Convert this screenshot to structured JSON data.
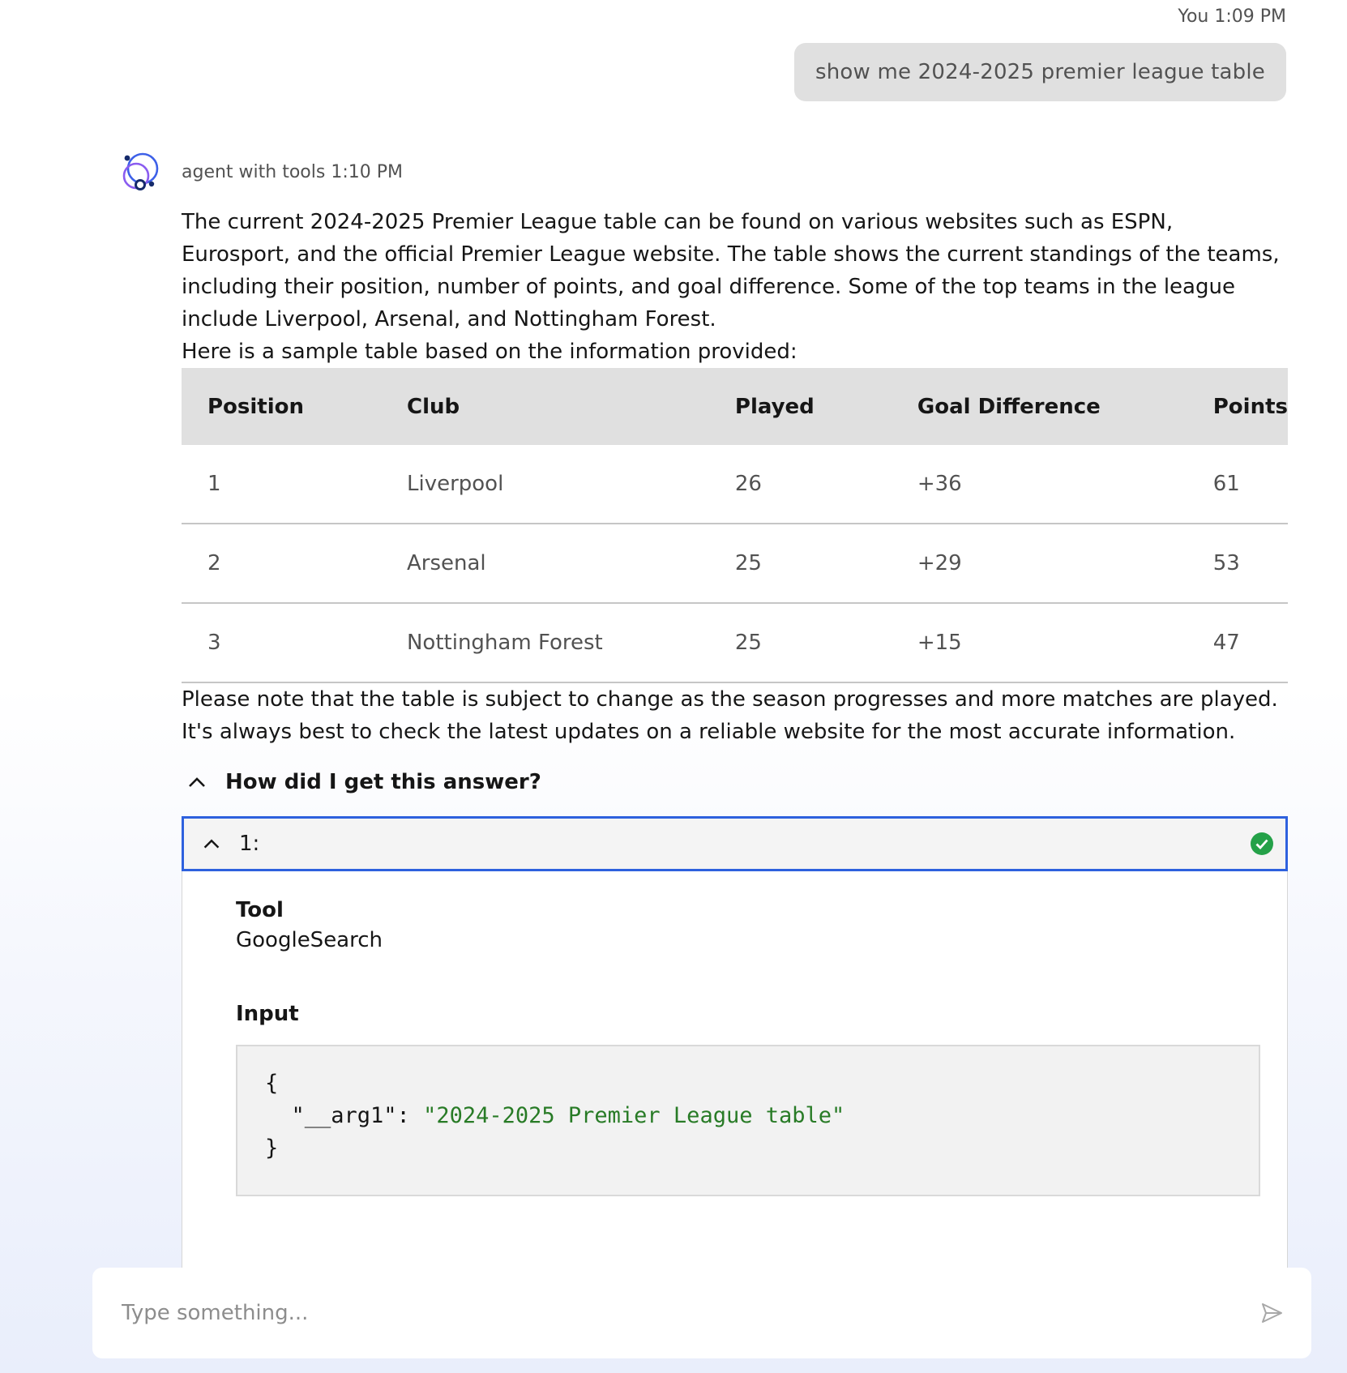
{
  "user_message": {
    "sender": "You",
    "time": "1:09 PM",
    "text": "show me 2024-2025 premier league table"
  },
  "agent_message": {
    "sender": "agent with tools",
    "time": "1:10 PM",
    "intro": "The current 2024-2025 Premier League table can be found on various websites such as ESPN, Eurosport, and the official Premier League website. The table shows the current standings of the teams, including their position, number of points, and goal difference. Some of the top teams in the league include Liverpool, Arsenal, and Nottingham Forest.",
    "table_intro": "Here is a sample table based on the information provided:",
    "table": {
      "headers": [
        "Position",
        "Club",
        "Played",
        "Goal Difference",
        "Points"
      ],
      "rows": [
        [
          "1",
          "Liverpool",
          "26",
          "+36",
          "61"
        ],
        [
          "2",
          "Arsenal",
          "25",
          "+29",
          "53"
        ],
        [
          "3",
          "Nottingham Forest",
          "25",
          "+15",
          "47"
        ]
      ]
    },
    "note": "Please note that the table is subject to change as the season progresses and more matches are played. It's always best to check the latest updates on a reliable website for the most accurate information."
  },
  "reasoning": {
    "toggle_label": "How did I get this answer?",
    "steps": [
      {
        "title": "1:",
        "status": "success",
        "tool_label": "Tool",
        "tool_value": "GoogleSearch",
        "input_label": "Input",
        "input_open": "{",
        "input_key": "\"__arg1\": ",
        "input_value": "\"2024-2025 Premier League table\"",
        "input_close": "}"
      }
    ]
  },
  "composer": {
    "placeholder": "Type something..."
  },
  "icons": {
    "avatar": "agent-avatar-icon",
    "toggle": "chevron-up-icon",
    "status": "check-circle-icon",
    "send": "send-icon"
  },
  "colors": {
    "accent": "#2e61de",
    "success": "#24a148",
    "code_string": "#287b26"
  }
}
